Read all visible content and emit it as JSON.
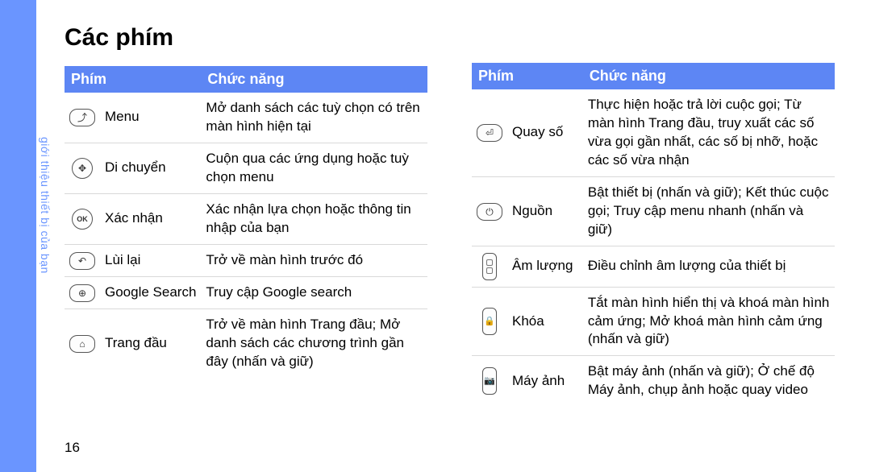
{
  "page_number": "16",
  "side_label": "giới thiệu thiết bị của bạn",
  "title": "Các phím",
  "headers": {
    "key": "Phím",
    "func": "Chức năng"
  },
  "left_rows": [
    {
      "icon": "menu",
      "name": "Menu",
      "func": "Mở danh sách các tuỳ chọn có trên màn hình hiện tại"
    },
    {
      "icon": "nav",
      "name": "Di chuyển",
      "func": "Cuộn qua các ứng dụng hoặc tuỳ chọn menu"
    },
    {
      "icon": "ok",
      "name": "Xác nhận",
      "func": "Xác nhận lựa chọn hoặc thông tin nhập của bạn"
    },
    {
      "icon": "back",
      "name": "Lùi lại",
      "func": "Trở về màn hình trước đó"
    },
    {
      "icon": "search",
      "name": "Google Search",
      "func": "Truy cập Google search"
    },
    {
      "icon": "home",
      "name": "Trang đầu",
      "func": "Trở về màn hình Trang đầu; Mở danh sách các chương trình gần đây (nhấn và giữ)"
    }
  ],
  "right_rows": [
    {
      "icon": "dial",
      "name": "Quay số",
      "func": "Thực hiện hoặc trả lời cuộc gọi; Từ màn hình Trang đầu, truy xuất các số vừa gọi gần nhất, các số bị nhỡ, hoặc các số vừa nhận"
    },
    {
      "icon": "power",
      "name": "Nguồn",
      "func": "Bật thiết bị (nhấn và giữ); Kết thúc cuộc gọi; Truy cập menu nhanh (nhấn và giữ)"
    },
    {
      "icon": "volume",
      "name": "Âm lượng",
      "func": "Điều chỉnh âm lượng của thiết bị"
    },
    {
      "icon": "lock",
      "name": "Khóa",
      "func": "Tắt màn hình hiển thị và khoá màn hình cảm ứng; Mở khoá màn hình cảm ứng (nhấn và giữ)"
    },
    {
      "icon": "camera",
      "name": "Máy ảnh",
      "func": "Bật máy ảnh (nhấn và giữ); Ở chế độ Máy ảnh, chụp ảnh hoặc quay video"
    }
  ]
}
